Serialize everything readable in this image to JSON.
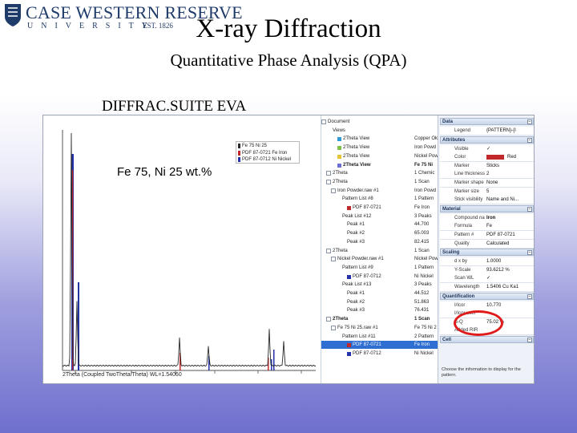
{
  "header": {
    "logo_line1": "CASE WESTERN RESERVE",
    "logo_line2": "UNIVERSITY",
    "logo_est": "EST. 1826",
    "title": "X-ray Diffraction",
    "subtitle": "Quantitative Phase Analysis (QPA)",
    "software": "DIFFRAC.SUITE EVA"
  },
  "chart": {
    "composition": "Fe 75, Ni 25 wt.%",
    "legend": [
      {
        "label": "Fe 75 Ni 25",
        "color": "#2a2a2a"
      },
      {
        "label": "PDF 87-0721 Fe Iron",
        "color": "#c0282a"
      },
      {
        "label": "PDF 87-0712 Ni Nickel",
        "color": "#2431a8"
      }
    ],
    "xlabel": "2Theta (Coupled TwoTheta/Theta) WL=1.54060",
    "colors": {
      "measured": "#2a2a2a",
      "fe": "#c0282a",
      "ni": "#2431a8"
    }
  },
  "tree": {
    "rows": [
      {
        "name": "Document",
        "value": "",
        "indent": 0,
        "chk": true
      },
      {
        "name": "Views",
        "value": "",
        "indent": 1
      },
      {
        "name": "2Theta View",
        "value": "Copper Ok",
        "indent": 2,
        "swatch": "#2e9bd6"
      },
      {
        "name": "2Theta View",
        "value": "Iron Powd",
        "indent": 2,
        "swatch": "#7fc24a"
      },
      {
        "name": "2Theta View",
        "value": "Nickel Pow",
        "indent": 2,
        "swatch": "#e3c437"
      },
      {
        "name": "2Theta View",
        "value": "Fe 75 Ni",
        "indent": 2,
        "swatch": "#6b6fd6",
        "bold": true
      },
      {
        "name": "2Theta",
        "value": "1 Chemic",
        "indent": 1,
        "chk": true
      },
      {
        "name": "2Theta",
        "value": "1 Scan",
        "indent": 1,
        "chk": true
      },
      {
        "name": "Iron Powder.raw #1",
        "value": "Iron Powd",
        "indent": 2,
        "chk": true
      },
      {
        "name": "Pattern List #8",
        "value": "1 Pattern",
        "indent": 3
      },
      {
        "name": "PDF 87-0721",
        "value": "Fe Iron",
        "indent": 4,
        "swatch": "#c0282a"
      },
      {
        "name": "Peak List #12",
        "value": "3 Peaks",
        "indent": 3
      },
      {
        "name": "Peak #1",
        "value": "44.700",
        "indent": 4
      },
      {
        "name": "Peak #2",
        "value": "65.003",
        "indent": 4
      },
      {
        "name": "Peak #3",
        "value": "82.415",
        "indent": 4
      },
      {
        "name": "2Theta",
        "value": "1 Scan",
        "indent": 1,
        "chk": true
      },
      {
        "name": "Nickel Powder.raw #1",
        "value": "Nickel Pow",
        "indent": 2,
        "chk": true
      },
      {
        "name": "Pattern List #9",
        "value": "1 Pattern",
        "indent": 3
      },
      {
        "name": "PDF 87-0712",
        "value": "Ni Nickel",
        "indent": 4,
        "swatch": "#2431a8"
      },
      {
        "name": "Peak List #13",
        "value": "3 Peaks",
        "indent": 3
      },
      {
        "name": "Peak #1",
        "value": "44.512",
        "indent": 4
      },
      {
        "name": "Peak #2",
        "value": "51.863",
        "indent": 4
      },
      {
        "name": "Peak #3",
        "value": "76.431",
        "indent": 4
      },
      {
        "name": "2Theta",
        "value": "1 Scan",
        "indent": 1,
        "chk": true,
        "bold": true
      },
      {
        "name": "Fe 75 Ni 25.raw #1",
        "value": "Fe 75 Ni 2",
        "indent": 2,
        "chk": true
      },
      {
        "name": "Pattern List #11",
        "value": "2 Pattern",
        "indent": 3
      },
      {
        "name": "PDF 87-0721",
        "value": "Fe Iron",
        "indent": 4,
        "swatch": "#c0282a",
        "sel": true
      },
      {
        "name": "PDF 87-0712",
        "value": "Ni Nickel",
        "indent": 4,
        "swatch": "#2431a8"
      }
    ]
  },
  "props": {
    "groups": [
      {
        "title": "Data",
        "rows": [
          {
            "label": "Legend",
            "value": "{PATTERN}-{I"
          }
        ]
      },
      {
        "title": "Attributes",
        "rows": [
          {
            "label": "Visible",
            "value": "✓"
          },
          {
            "label": "Color",
            "value": "Red",
            "swatch": "#c0282a"
          },
          {
            "label": "Marker",
            "value": "Sticks"
          },
          {
            "label": "Line thickness",
            "value": "2"
          },
          {
            "label": "Marker shape",
            "value": "None"
          },
          {
            "label": "Marker size",
            "value": "5"
          },
          {
            "label": "Stick visibility",
            "value": "Name and Ni..."
          }
        ]
      },
      {
        "title": "Material",
        "rows": [
          {
            "label": "Compound name",
            "value": "Iron",
            "hl": true
          },
          {
            "label": "Formula",
            "value": "Fe"
          },
          {
            "label": "Pattern #",
            "value": "PDF 87-0721"
          },
          {
            "label": "Quality",
            "value": "Calculated"
          }
        ]
      },
      {
        "title": "Scaling",
        "rows": [
          {
            "label": "d x by",
            "value": "1.0000"
          },
          {
            "label": "Y-Scale",
            "value": "93.6212 %"
          },
          {
            "label": "Scan WL",
            "value": "✓"
          },
          {
            "label": "Wavelength",
            "value": "1.5406 Cu Ka1"
          }
        ]
      },
      {
        "title": "Quantification",
        "rows": [
          {
            "label": "I/Icor",
            "value": "10.770"
          },
          {
            "label": "I/Icor user",
            "value": ""
          },
          {
            "label": "S-Q",
            "value": "75.02 %"
          },
          {
            "label": "Added RIR",
            "value": ""
          }
        ]
      },
      {
        "title": "Cell",
        "rows": []
      }
    ],
    "hint": "Choose the information to display for the pattern."
  }
}
